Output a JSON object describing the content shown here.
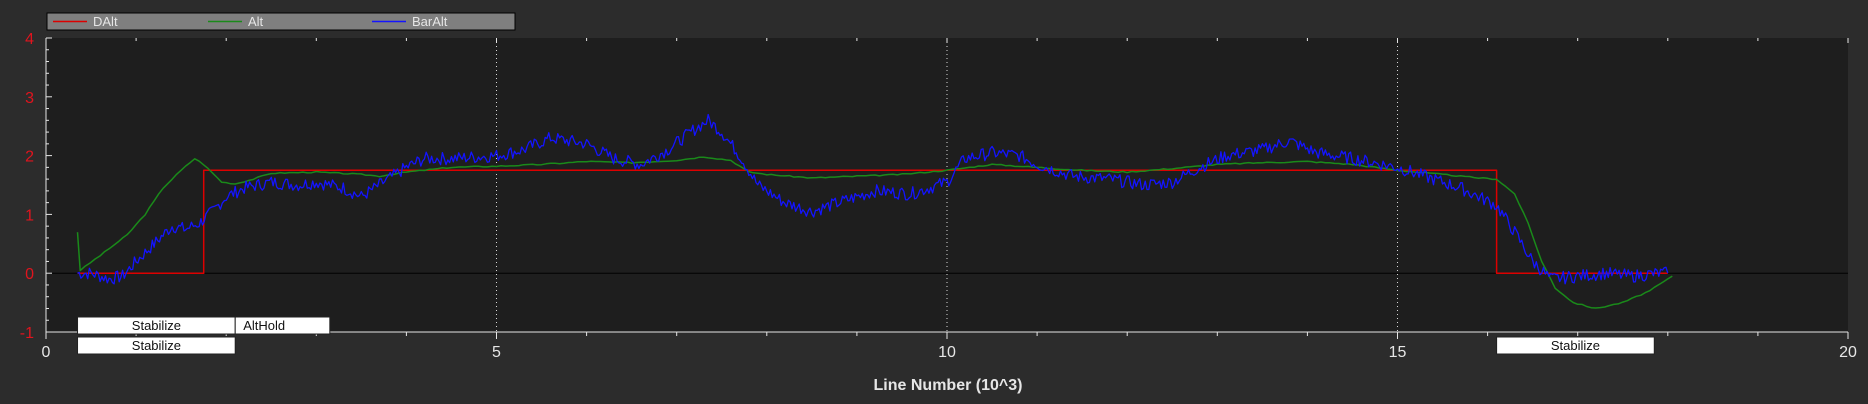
{
  "chart_data": {
    "type": "line",
    "title": "",
    "xlabel": "Line Number (10^3)",
    "ylabel": "",
    "xlim": [
      0,
      20
    ],
    "ylim": [
      -1,
      4
    ],
    "x_ticks": [
      "0",
      "5",
      "10",
      "15",
      "20"
    ],
    "y_ticks": [
      "-1",
      "0",
      "1",
      "2",
      "3",
      "4"
    ],
    "grid": "dotted vertical at major x ticks",
    "legend_position": "top-left",
    "colors": {
      "background": "#2c2c2c",
      "plot": "#1e1e1e",
      "axis": "#e6e6e6",
      "ytick_text": "#e0141e",
      "zero_line": "#000000",
      "legend_box": "#7f7f7f"
    },
    "series": [
      {
        "name": "DAlt",
        "color": "#dd0000",
        "points": [
          [
            0.35,
            0
          ],
          [
            1.75,
            0
          ],
          [
            1.75,
            1.75
          ],
          [
            16.1,
            1.75
          ],
          [
            16.1,
            0
          ],
          [
            18,
            0
          ]
        ]
      },
      {
        "name": "Alt",
        "color": "#1a8a1a",
        "points": [
          [
            0.35,
            0.7
          ],
          [
            0.38,
            0.05
          ],
          [
            0.6,
            0.3
          ],
          [
            0.9,
            0.65
          ],
          [
            1.1,
            1.0
          ],
          [
            1.3,
            1.45
          ],
          [
            1.5,
            1.75
          ],
          [
            1.65,
            1.95
          ],
          [
            1.75,
            1.85
          ],
          [
            1.95,
            1.55
          ],
          [
            2.1,
            1.52
          ],
          [
            2.3,
            1.6
          ],
          [
            2.5,
            1.7
          ],
          [
            3.0,
            1.72
          ],
          [
            3.5,
            1.68
          ],
          [
            3.7,
            1.65
          ],
          [
            4.0,
            1.72
          ],
          [
            4.5,
            1.8
          ],
          [
            5.0,
            1.82
          ],
          [
            5.5,
            1.85
          ],
          [
            6.0,
            1.9
          ],
          [
            6.5,
            1.88
          ],
          [
            7.0,
            1.92
          ],
          [
            7.3,
            1.98
          ],
          [
            7.6,
            1.92
          ],
          [
            7.8,
            1.72
          ],
          [
            8.0,
            1.68
          ],
          [
            8.5,
            1.62
          ],
          [
            9.0,
            1.65
          ],
          [
            9.5,
            1.68
          ],
          [
            10.0,
            1.75
          ],
          [
            10.5,
            1.85
          ],
          [
            11.0,
            1.8
          ],
          [
            11.5,
            1.75
          ],
          [
            12.0,
            1.72
          ],
          [
            12.5,
            1.78
          ],
          [
            13.0,
            1.85
          ],
          [
            13.5,
            1.88
          ],
          [
            14.0,
            1.9
          ],
          [
            14.5,
            1.85
          ],
          [
            15.0,
            1.75
          ],
          [
            15.5,
            1.68
          ],
          [
            15.9,
            1.62
          ],
          [
            16.1,
            1.6
          ],
          [
            16.3,
            1.35
          ],
          [
            16.45,
            0.85
          ],
          [
            16.6,
            0.2
          ],
          [
            16.75,
            -0.25
          ],
          [
            16.95,
            -0.5
          ],
          [
            17.2,
            -0.6
          ],
          [
            17.5,
            -0.5
          ],
          [
            17.8,
            -0.3
          ],
          [
            18.05,
            -0.05
          ]
        ]
      },
      {
        "name": "BarAlt",
        "color": "#1414ff",
        "points": [
          [
            0.35,
            0.0
          ],
          [
            0.5,
            0.0
          ],
          [
            0.7,
            -0.1
          ],
          [
            0.85,
            -0.05
          ],
          [
            1.0,
            0.2
          ],
          [
            1.2,
            0.5
          ],
          [
            1.4,
            0.8
          ],
          [
            1.55,
            0.75
          ],
          [
            1.7,
            0.85
          ],
          [
            1.85,
            1.05
          ],
          [
            2.0,
            1.3
          ],
          [
            2.2,
            1.45
          ],
          [
            2.5,
            1.55
          ],
          [
            2.8,
            1.5
          ],
          [
            3.0,
            1.55
          ],
          [
            3.3,
            1.45
          ],
          [
            3.5,
            1.3
          ],
          [
            3.7,
            1.5
          ],
          [
            4.0,
            1.8
          ],
          [
            4.2,
            1.95
          ],
          [
            4.5,
            1.95
          ],
          [
            5.0,
            2.0
          ],
          [
            5.3,
            2.1
          ],
          [
            5.6,
            2.3
          ],
          [
            6.0,
            2.2
          ],
          [
            6.3,
            1.95
          ],
          [
            6.6,
            1.85
          ],
          [
            6.9,
            2.1
          ],
          [
            7.2,
            2.45
          ],
          [
            7.35,
            2.6
          ],
          [
            7.5,
            2.4
          ],
          [
            7.7,
            2.0
          ],
          [
            7.9,
            1.5
          ],
          [
            8.2,
            1.2
          ],
          [
            8.5,
            1.05
          ],
          [
            8.8,
            1.2
          ],
          [
            9.2,
            1.4
          ],
          [
            9.6,
            1.35
          ],
          [
            10.0,
            1.55
          ],
          [
            10.2,
            1.95
          ],
          [
            10.5,
            2.05
          ],
          [
            10.8,
            2.0
          ],
          [
            11.0,
            1.85
          ],
          [
            11.4,
            1.65
          ],
          [
            11.8,
            1.6
          ],
          [
            12.2,
            1.5
          ],
          [
            12.5,
            1.55
          ],
          [
            12.8,
            1.8
          ],
          [
            13.1,
            2.0
          ],
          [
            13.5,
            2.1
          ],
          [
            13.8,
            2.25
          ],
          [
            14.1,
            2.05
          ],
          [
            14.5,
            1.95
          ],
          [
            15.0,
            1.8
          ],
          [
            15.4,
            1.6
          ],
          [
            15.7,
            1.45
          ],
          [
            15.9,
            1.3
          ],
          [
            16.1,
            1.15
          ],
          [
            16.3,
            0.7
          ],
          [
            16.5,
            0.2
          ],
          [
            16.7,
            -0.1
          ],
          [
            17.0,
            -0.05
          ],
          [
            17.3,
            0.0
          ],
          [
            17.6,
            -0.05
          ],
          [
            17.9,
            0.0
          ],
          [
            18.0,
            0.0
          ]
        ]
      }
    ],
    "mode_labels": [
      {
        "text": "Stabilize",
        "row": 1,
        "x_start": 0.35,
        "x_end": 2.1
      },
      {
        "text": "AltHold",
        "row": 1,
        "x_start": 2.1,
        "x_end": 3.15
      },
      {
        "text": "Stabilize",
        "row": 2,
        "x_start": 0.35,
        "x_end": 2.1
      },
      {
        "text": "Stabilize",
        "row": 2,
        "x_start": 16.1,
        "x_end": 17.85
      }
    ]
  }
}
